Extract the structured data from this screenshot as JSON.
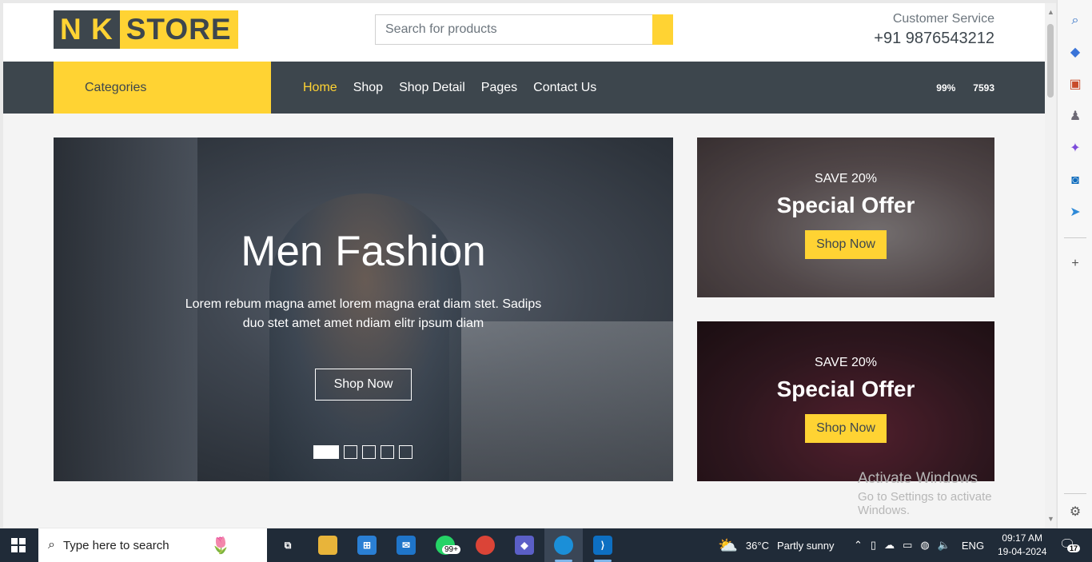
{
  "logo": {
    "part1": "N K",
    "part2": "STORE"
  },
  "search": {
    "placeholder": "Search for products"
  },
  "customer_service": {
    "title": "Customer Service",
    "phone": "+91 9876543212"
  },
  "navbar": {
    "categories_label": "Categories",
    "links": [
      "Home",
      "Shop",
      "Shop Detail",
      "Pages",
      "Contact Us"
    ],
    "active": "Home",
    "stats": [
      "99%",
      "7593"
    ]
  },
  "carousel": {
    "title": "Men Fashion",
    "description": "Lorem rebum magna amet lorem magna erat diam stet. Sadips duo stet amet amet ndiam elitr ipsum diam",
    "button": "Shop Now",
    "slides": 5,
    "active_slide": 1
  },
  "offers": [
    {
      "save": "SAVE 20%",
      "heading": "Special Offer",
      "button": "Shop Now"
    },
    {
      "save": "SAVE 20%",
      "heading": "Special Offer",
      "button": "Shop Now"
    }
  ],
  "watermark": {
    "line1": "Activate Windows",
    "line2": "Go to Settings to activate Windows."
  },
  "sidebar_icons": [
    "search-icon",
    "tag-icon",
    "toolbox-icon",
    "chess-icon",
    "copilot-icon",
    "outlook-icon",
    "paper-plane-icon",
    "plus-icon",
    "settings-icon"
  ],
  "taskbar": {
    "search_text": "Type here to search",
    "whatsapp_badge": "99+",
    "weather": {
      "temp": "36°C",
      "condition": "Partly sunny"
    },
    "lang": "ENG",
    "time": "09:17 AM",
    "date": "19-04-2024",
    "notifications": "17"
  },
  "colors": {
    "accent": "#ffd333",
    "dark": "#3d464d",
    "taskbar": "#202b38"
  }
}
